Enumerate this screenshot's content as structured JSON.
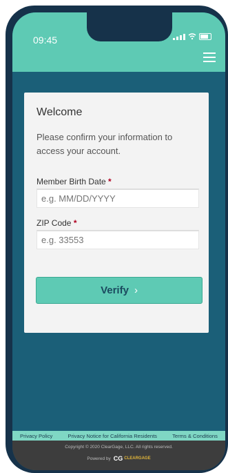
{
  "status_bar": {
    "time": "09:45"
  },
  "form": {
    "title": "Welcome",
    "message": "Please confirm your information to access your account.",
    "birth_date_label": "Member Birth Date",
    "birth_date_placeholder": "e.g. MM/DD/YYYY",
    "zip_label": "ZIP Code",
    "zip_placeholder": "e.g. 33553",
    "required_marker": "*",
    "verify_label": "Verify",
    "verify_chevron": "›"
  },
  "footer": {
    "links": [
      "Privacy Policy",
      "Privacy Notice for California Residents",
      "Terms & Conditions"
    ],
    "copyright": "Copyright © 2020 ClearGage, LLC. All rights reserved.",
    "powered_by": "Powered by",
    "logo_mark": "CG",
    "logo_text": "CLEARGAGE"
  },
  "colors": {
    "accent": "#5ecab4",
    "page_bg": "#1b5f78",
    "card_bg": "#f3f3f3",
    "required": "#b00020"
  }
}
